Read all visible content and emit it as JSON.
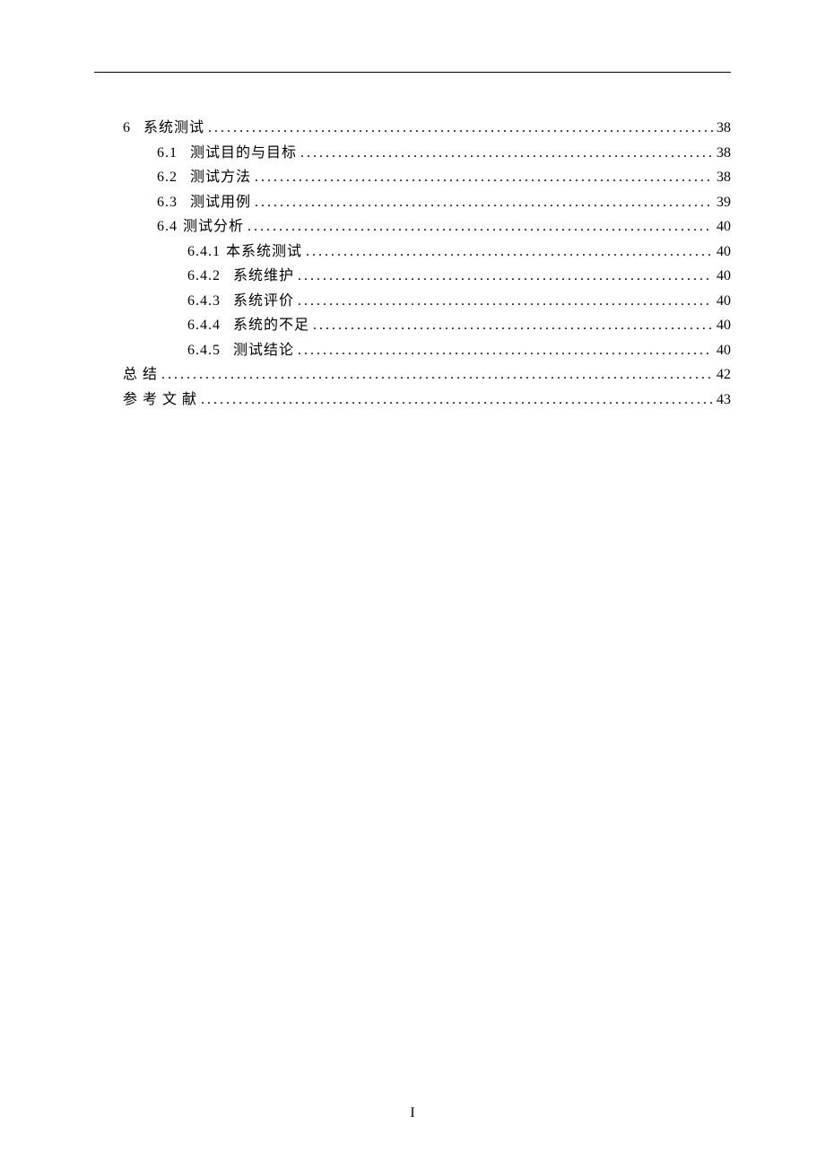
{
  "toc": [
    {
      "indent": "indent-1",
      "num": "6",
      "numClass": "num",
      "label": "系统测试",
      "labelClass": "label",
      "page": "38"
    },
    {
      "indent": "indent-2",
      "num": "6.1",
      "numClass": "num-sub",
      "label": "测试目的与目标",
      "labelClass": "label",
      "page": "38"
    },
    {
      "indent": "indent-2",
      "num": "6.2",
      "numClass": "num-sub",
      "label": "测试方法",
      "labelClass": "label",
      "page": "38"
    },
    {
      "indent": "indent-2",
      "num": "6.3",
      "numClass": "num-sub",
      "label": "测试用例",
      "labelClass": "label",
      "page": "39"
    },
    {
      "indent": "indent-2b",
      "num": "6.4",
      "numClass": "num-tight",
      "label": "测试分析",
      "labelClass": "label",
      "page": "40"
    },
    {
      "indent": "indent-3",
      "num": "6.4.1",
      "numClass": "num-tight",
      "label": "本系统测试",
      "labelClass": "label",
      "page": "40"
    },
    {
      "indent": "indent-3",
      "num": "6.4.2",
      "numClass": "num-sub",
      "label": "系统维护",
      "labelClass": "label",
      "page": "40"
    },
    {
      "indent": "indent-3",
      "num": "6.4.3",
      "numClass": "num-sub",
      "label": "系统评价",
      "labelClass": "label",
      "page": "40"
    },
    {
      "indent": "indent-3",
      "num": "6.4.4",
      "numClass": "num-sub",
      "label": "系统的不足",
      "labelClass": "label",
      "page": "40"
    },
    {
      "indent": "indent-3",
      "num": "6.4.5",
      "numClass": "num-sub",
      "label": "测试结论",
      "labelClass": "label",
      "page": "40"
    },
    {
      "indent": "indent-0",
      "num": "",
      "numClass": "",
      "label": "总 结",
      "labelClass": "label",
      "page": "42"
    },
    {
      "indent": "indent-0",
      "num": "",
      "numClass": "",
      "label": "参 考 文 献",
      "labelClass": "label",
      "page": "43"
    }
  ],
  "footer": {
    "pageNumber": "I"
  }
}
